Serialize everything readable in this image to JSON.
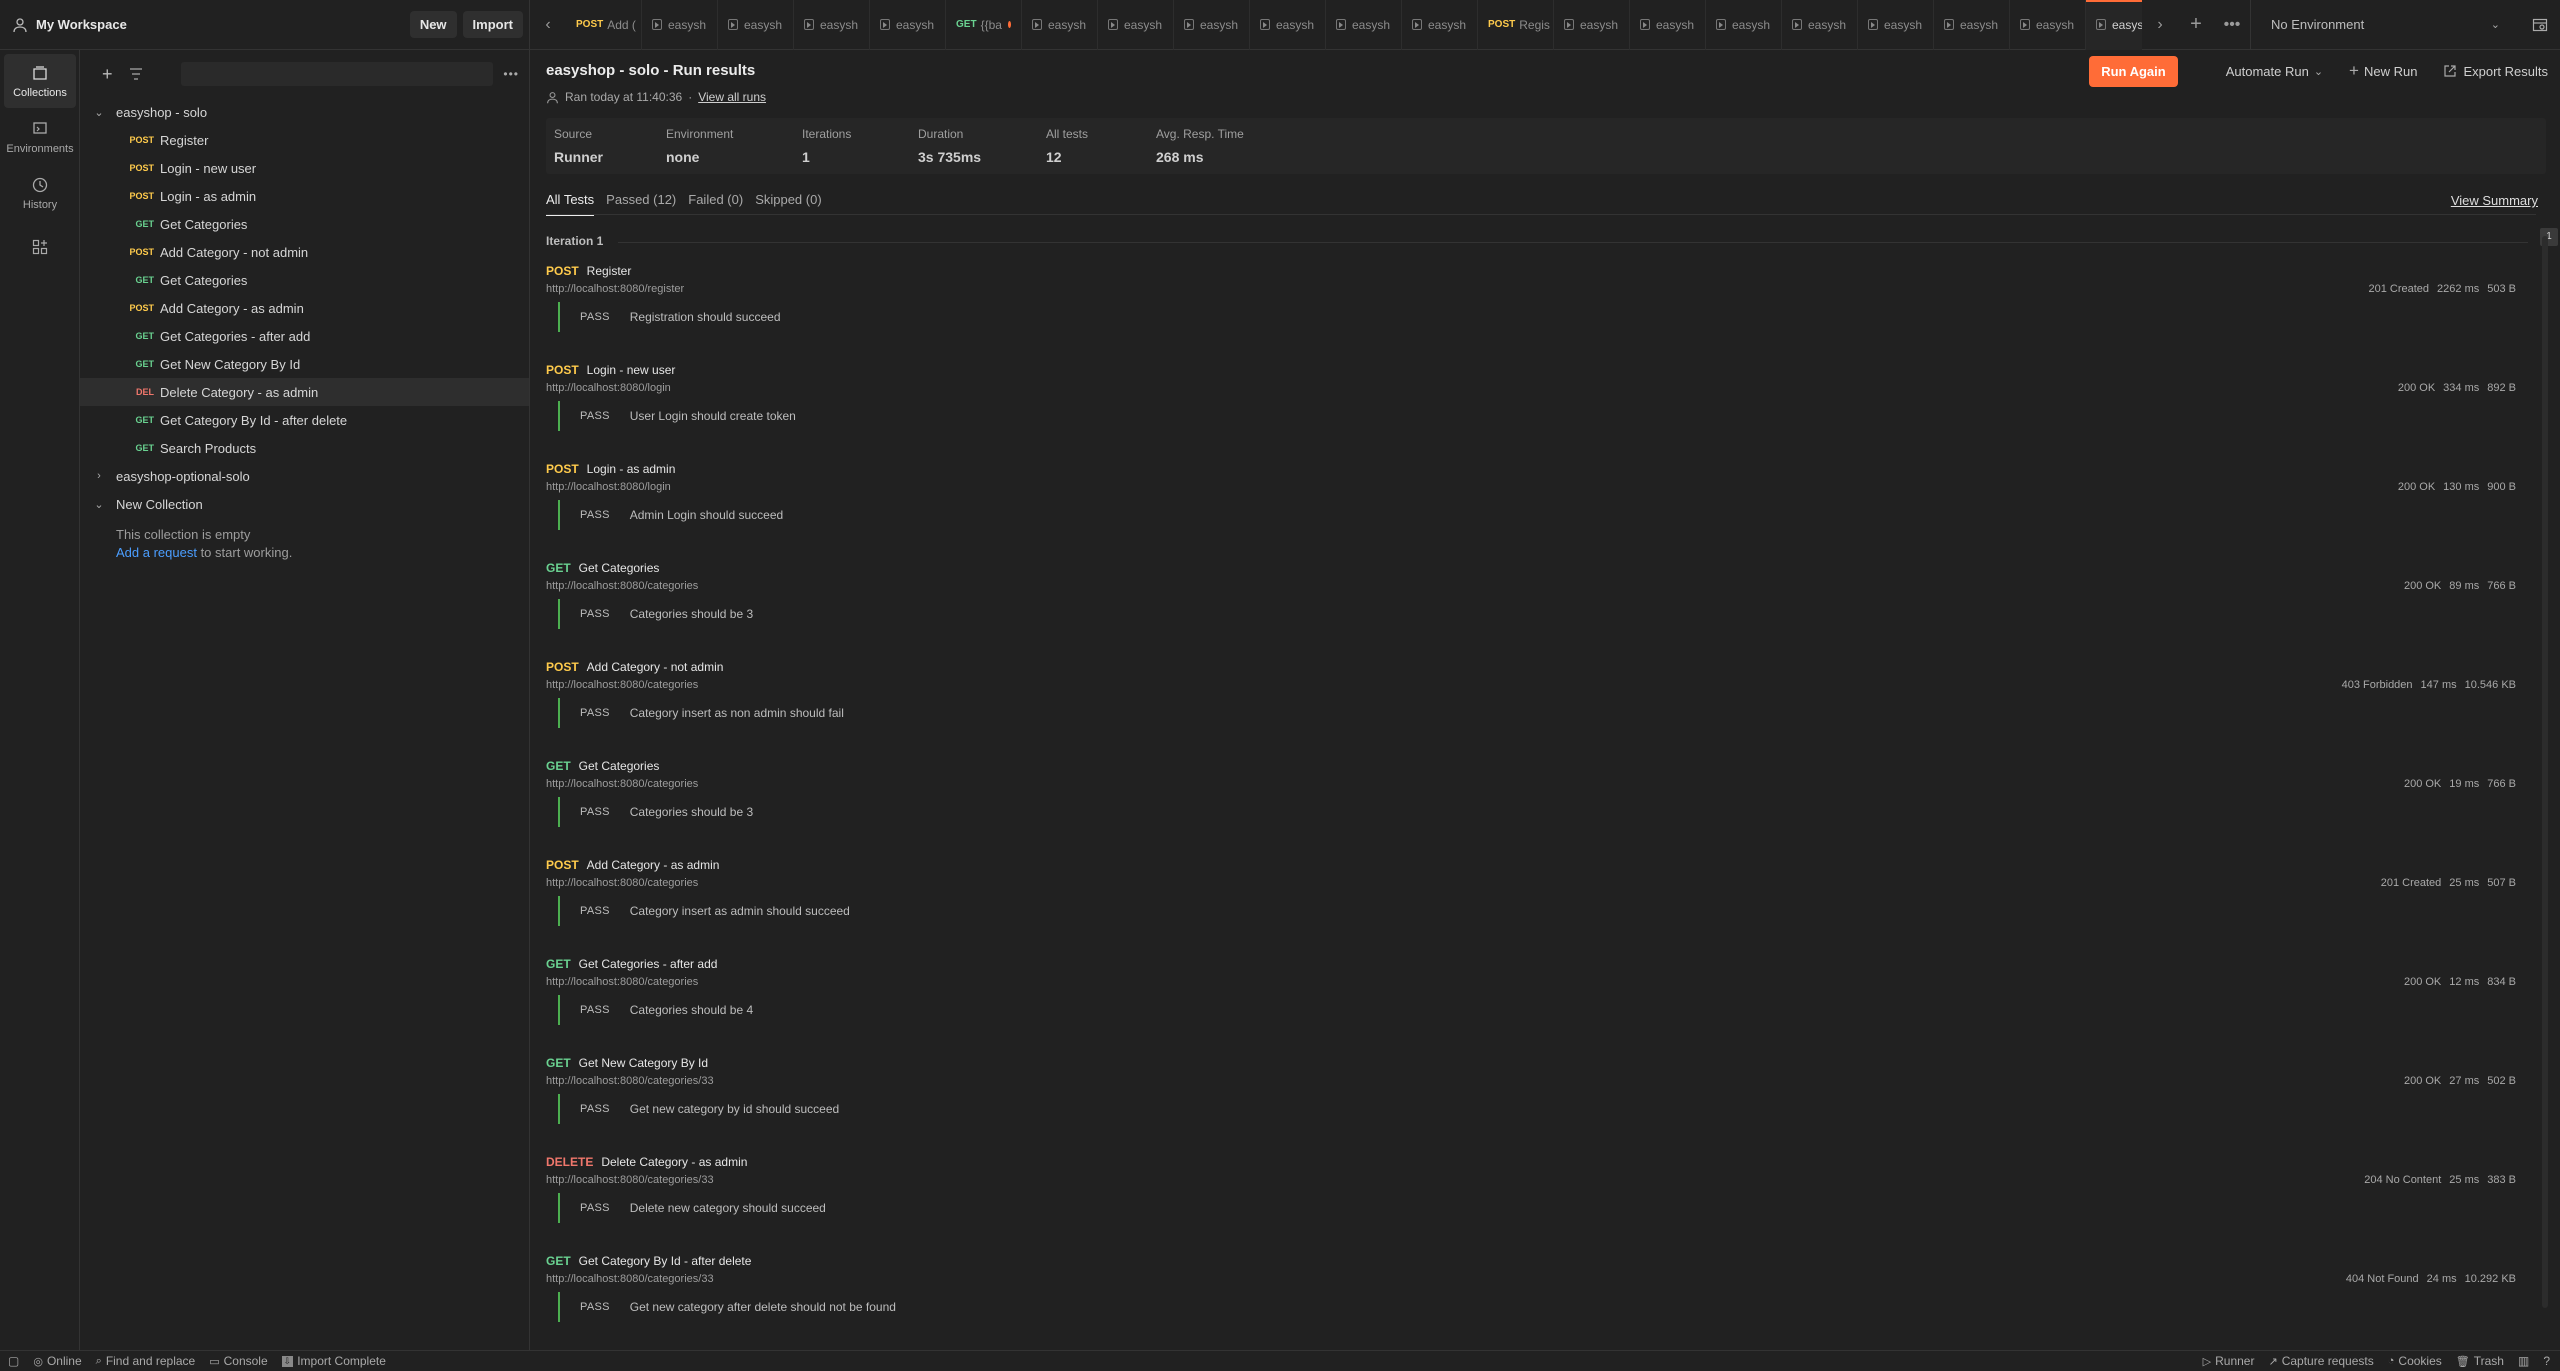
{
  "workspace": {
    "name": "My Workspace",
    "new_label": "New",
    "import_label": "Import"
  },
  "tabs": [
    {
      "method": "POST",
      "label": "Add (",
      "kind": "request"
    },
    {
      "method": "",
      "label": "easysh",
      "kind": "runner"
    },
    {
      "method": "",
      "label": "easysh",
      "kind": "runner"
    },
    {
      "method": "",
      "label": "easysh",
      "kind": "collection"
    },
    {
      "method": "",
      "label": "easysh",
      "kind": "runner"
    },
    {
      "method": "GET",
      "label": "{{ba",
      "kind": "request",
      "unsaved": true
    },
    {
      "method": "",
      "label": "easysh",
      "kind": "runner"
    },
    {
      "method": "",
      "label": "easysh",
      "kind": "runner"
    },
    {
      "method": "",
      "label": "easysh",
      "kind": "runner"
    },
    {
      "method": "",
      "label": "easysh",
      "kind": "runner"
    },
    {
      "method": "",
      "label": "easysh",
      "kind": "runner"
    },
    {
      "method": "",
      "label": "easysh",
      "kind": "runner"
    },
    {
      "method": "POST",
      "label": "Regis",
      "kind": "request"
    },
    {
      "method": "",
      "label": "easysh",
      "kind": "runner"
    },
    {
      "method": "",
      "label": "easysh",
      "kind": "runner"
    },
    {
      "method": "",
      "label": "easysh",
      "kind": "runner"
    },
    {
      "method": "",
      "label": "easysh",
      "kind": "runner"
    },
    {
      "method": "",
      "label": "easysh",
      "kind": "runner"
    },
    {
      "method": "",
      "label": "easysh",
      "kind": "runner"
    },
    {
      "method": "",
      "label": "easysh",
      "kind": "runner"
    },
    {
      "method": "",
      "label": "easysh",
      "kind": "runner",
      "active": true
    }
  ],
  "environment": {
    "selected": "No Environment"
  },
  "rail": [
    {
      "label": "Collections",
      "active": true
    },
    {
      "label": "Environments"
    },
    {
      "label": "History"
    }
  ],
  "sidebar": {
    "collection1": {
      "name": "easyshop - solo",
      "items": [
        {
          "method": "POST",
          "name": "Register"
        },
        {
          "method": "POST",
          "name": "Login - new user"
        },
        {
          "method": "POST",
          "name": "Login - as admin"
        },
        {
          "method": "GET",
          "name": "Get Categories"
        },
        {
          "method": "POST",
          "name": "Add Category - not admin"
        },
        {
          "method": "GET",
          "name": "Get Categories"
        },
        {
          "method": "POST",
          "name": "Add Category - as admin"
        },
        {
          "method": "GET",
          "name": "Get Categories - after add"
        },
        {
          "method": "GET",
          "name": "Get New Category By Id"
        },
        {
          "method": "DEL",
          "name": "Delete Category - as admin",
          "selected": true
        },
        {
          "method": "GET",
          "name": "Get Category By Id - after delete"
        },
        {
          "method": "GET",
          "name": "Search Products"
        }
      ]
    },
    "collection2": {
      "name": "easyshop-optional-solo"
    },
    "collection3": {
      "name": "New Collection",
      "empty_text": "This collection is empty",
      "add_link": "Add a request",
      "add_suffix": " to start working."
    }
  },
  "run": {
    "title": "easyshop - solo - Run results",
    "ran_at": "Ran today at 11:40:36",
    "view_all": "View all runs",
    "run_again": "Run Again",
    "automate": "Automate Run",
    "new_run": "New Run",
    "export": "Export Results",
    "summary": [
      {
        "label": "Source",
        "value": "Runner"
      },
      {
        "label": "Environment",
        "value": "none"
      },
      {
        "label": "Iterations",
        "value": "1"
      },
      {
        "label": "Duration",
        "value": "3s 735ms"
      },
      {
        "label": "All tests",
        "value": "12"
      },
      {
        "label": "Avg. Resp. Time",
        "value": "268 ms"
      }
    ],
    "filters": [
      "All Tests",
      "Passed (12)",
      "Failed (0)",
      "Skipped (0)"
    ],
    "view_summary": "View Summary",
    "iteration_label": "Iteration 1",
    "iteration_badge": "1",
    "results": [
      {
        "method": "POST",
        "name": "Register",
        "url": "http://localhost:8080/register",
        "status": "201 Created",
        "time": "2262 ms",
        "size": "503 B",
        "test": "Registration should succeed"
      },
      {
        "method": "POST",
        "name": "Login - new user",
        "url": "http://localhost:8080/login",
        "status": "200 OK",
        "time": "334 ms",
        "size": "892 B",
        "test": "User Login should create token"
      },
      {
        "method": "POST",
        "name": "Login - as admin",
        "url": "http://localhost:8080/login",
        "status": "200 OK",
        "time": "130 ms",
        "size": "900 B",
        "test": "Admin Login should succeed"
      },
      {
        "method": "GET",
        "name": "Get Categories",
        "url": "http://localhost:8080/categories",
        "status": "200 OK",
        "time": "89 ms",
        "size": "766 B",
        "test": "Categories should be 3"
      },
      {
        "method": "POST",
        "name": "Add Category - not admin",
        "url": "http://localhost:8080/categories",
        "status": "403 Forbidden",
        "time": "147 ms",
        "size": "10.546 KB",
        "test": "Category insert as non admin should fail"
      },
      {
        "method": "GET",
        "name": "Get Categories",
        "url": "http://localhost:8080/categories",
        "status": "200 OK",
        "time": "19 ms",
        "size": "766 B",
        "test": "Categories should be 3"
      },
      {
        "method": "POST",
        "name": "Add Category - as admin",
        "url": "http://localhost:8080/categories",
        "status": "201 Created",
        "time": "25 ms",
        "size": "507 B",
        "test": "Category insert as admin should succeed"
      },
      {
        "method": "GET",
        "name": "Get Categories - after add",
        "url": "http://localhost:8080/categories",
        "status": "200 OK",
        "time": "12 ms",
        "size": "834 B",
        "test": "Categories should be 4"
      },
      {
        "method": "GET",
        "name": "Get New Category By Id",
        "url": "http://localhost:8080/categories/33",
        "status": "200 OK",
        "time": "27 ms",
        "size": "502 B",
        "test": "Get new category by id should succeed"
      },
      {
        "method": "DELETE",
        "name": "Delete Category - as admin",
        "url": "http://localhost:8080/categories/33",
        "status": "204 No Content",
        "time": "25 ms",
        "size": "383 B",
        "test": "Delete new category should succeed"
      },
      {
        "method": "GET",
        "name": "Get Category By Id - after delete",
        "url": "http://localhost:8080/categories/33",
        "status": "404 Not Found",
        "time": "24 ms",
        "size": "10.292 KB",
        "test": "Get new category after delete should not be found"
      }
    ],
    "pass_label": "PASS"
  },
  "statusbar": {
    "online": "Online",
    "find": "Find and replace",
    "console": "Console",
    "import": "Import Complete",
    "runner": "Runner",
    "capture": "Capture requests",
    "cookies": "Cookies",
    "trash": "Trash"
  },
  "colors": {
    "accent": "#ff6c37",
    "post": "#ffcb4c",
    "get": "#6ad291",
    "delete": "#f0776c",
    "pass": "#4caf50"
  }
}
